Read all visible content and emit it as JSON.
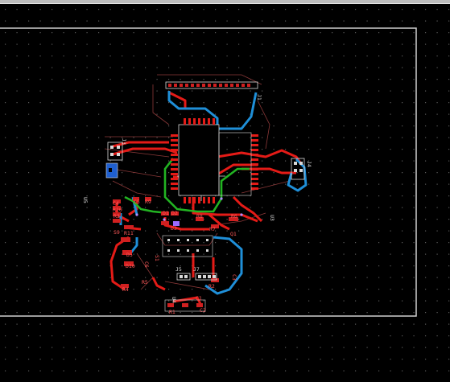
{
  "view": {
    "background": "#000000",
    "grid_color": "#5a5a5a",
    "board_outline_color": "#d0d0d0"
  },
  "colors": {
    "top_trace": "#e41b17",
    "bottom_trace": "#1f8fd8",
    "routed_green": "#22b322",
    "silkscreen": "#d9d9d9",
    "component_label": "#ff5a5a",
    "airwire": "#a24b4b",
    "via": "#b48cff"
  },
  "components": {
    "j1": "J1",
    "j2": "J2",
    "j3": "J3",
    "j4": "J4",
    "j5": "J5",
    "j7": "J7",
    "u1": "U1",
    "u2": "U2",
    "u3": "U3",
    "u4": "U4",
    "u5": "U5",
    "u6": "U6",
    "r1": "R1",
    "r2": "R2",
    "r3": "R3",
    "r4": "R4",
    "r5": "R5",
    "r6": "R6",
    "r7": "R7",
    "r8": "R8",
    "r9": "R9",
    "r10": "R10",
    "r11": "R11",
    "d1": "D1",
    "d2": "D2",
    "d3": "D3",
    "c1": "C1",
    "c2": "C2",
    "c3": "C3",
    "c4": "C4",
    "c5": "C5",
    "c6": "C6",
    "s1": "S1",
    "q1": "Q1",
    "d5": "D5",
    "d10": "D10",
    "r1b": "R1",
    "s9": "S9"
  }
}
